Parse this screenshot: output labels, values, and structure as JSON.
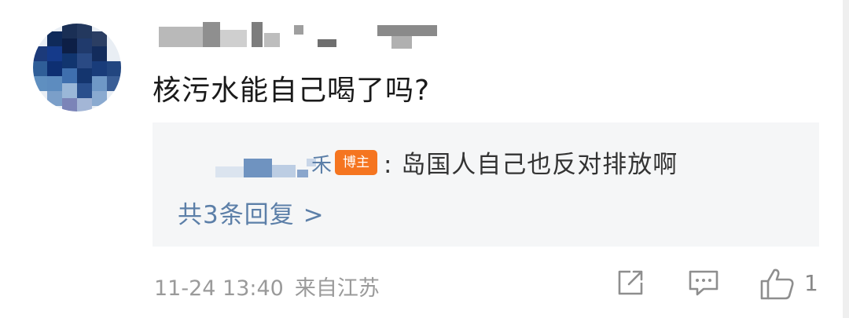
{
  "comment": {
    "text": "核污水能自己喝了吗?",
    "reply": {
      "badge": "博主",
      "content": ": 岛国人自己也反对排放啊",
      "username_tail": "禾"
    },
    "reply_count_label": "共3条回复 >",
    "timestamp": "11-24 13:40",
    "location": "来自江苏",
    "like_count": "1"
  },
  "icons": {
    "share": "share-icon",
    "comment": "comment-icon",
    "like": "thumbs-up-icon"
  },
  "colors": {
    "link": "#5c7fa8",
    "badge": "#f57520",
    "reply_bg": "#f5f6f7",
    "meta": "#9a9a9a"
  }
}
